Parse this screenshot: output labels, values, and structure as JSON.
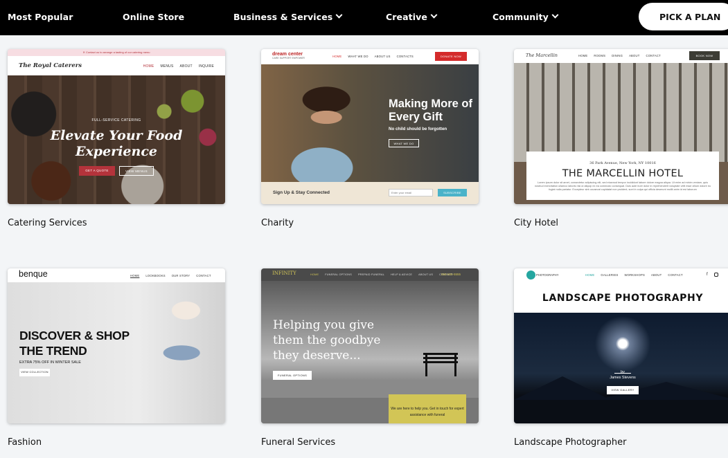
{
  "nav": {
    "most_popular": "Most Popular",
    "online_store": "Online Store",
    "business_services": "Business & Services",
    "creative": "Creative",
    "community": "Community",
    "pick_plan": "PICK A PLAN"
  },
  "cards": {
    "catering": {
      "label": "Catering Services",
      "topbar": "Contact us to arrange a tasting of our catering menu",
      "logo": "The Royal Caterers",
      "links": [
        "HOME",
        "MENUS",
        "ABOUT",
        "INQUIRE"
      ],
      "kicker": "FULL-SERVICE CATERING",
      "title": "Elevate Your Food Experience",
      "btn_quote": "GET A QUOTE",
      "btn_menus": "VIEW MENUS"
    },
    "charity": {
      "label": "Charity",
      "logo": "dream center",
      "logo_sub": "CARE SUPPORT EMPOWER",
      "links": [
        "HOME",
        "WHAT WE DO",
        "ABOUT US",
        "CONTACTS"
      ],
      "donate": "DONATE NOW",
      "title": "Making More of Every Gift",
      "subtitle": "No child should be forgotten",
      "btn": "WHAT WE DO",
      "signup": "Sign Up & Stay Connected",
      "email_placeholder": "Enter your email",
      "subscribe": "SUBSCRIBE"
    },
    "hotel": {
      "label": "City Hotel",
      "logo": "The Marcellin",
      "links": [
        "HOME",
        "ROOMS",
        "DINING",
        "ABOUT",
        "CONTACT"
      ],
      "book": "BOOK NOW",
      "address": "36 Park Avenue, New York, NY 10016",
      "title": "THE MARCELLIN HOTEL",
      "desc": "Lorem ipsum dolor sit amet, consectetur adipiscing elit, sed eiusmod tempor incididunt labore dolore magna aliqua. Ut enim ad minim veniam, quis nostrud exercitation ullamco laboris nisi ut aliquip ex ea commodo consequat. Duis aute irure dolor in reprehenderit voluptate velit esse cillum dolore eu fugiat nulla pariatur. Excepteur sint occaecat cupidatat non proident, sunt in culpa qui officia deserunt mollit anim id est laborum"
    },
    "fashion": {
      "label": "Fashion",
      "logo": "benque",
      "links": [
        "HOME",
        "LOOKBOOKS",
        "OUR STORY",
        "CONTACT"
      ],
      "title": "DISCOVER & SHOP THE TREND",
      "promo": "EXTRA 75% OFF IN WINTER SALE",
      "btn": "VIEW COLLECTION"
    },
    "funeral": {
      "label": "Funeral Services",
      "logo": "INFINITY",
      "links": [
        "HOME",
        "FUNERAL OPTIONS",
        "PREPAID FUNERAL",
        "HELP & ADVICE",
        "ABOUT US",
        "CONTACT"
      ],
      "phone": "555-555-5555",
      "title": "Helping you give them the goodbye they deserve...",
      "btn": "FUNERAL OPTIONS",
      "box": "We are here to help you. Get in touch for expert assistance with funeral"
    },
    "landscape": {
      "label": "Landscape Photographer",
      "logo": "PHOTOGRAPHY",
      "links": [
        "HOME",
        "GALLERIES",
        "WORKSHOPS",
        "ABOUT",
        "CONTACT"
      ],
      "title": "LANDSCAPE PHOTOGRAPHY",
      "by": "by",
      "author": "James Stevens",
      "btn": "VIEW GALLERY"
    }
  }
}
